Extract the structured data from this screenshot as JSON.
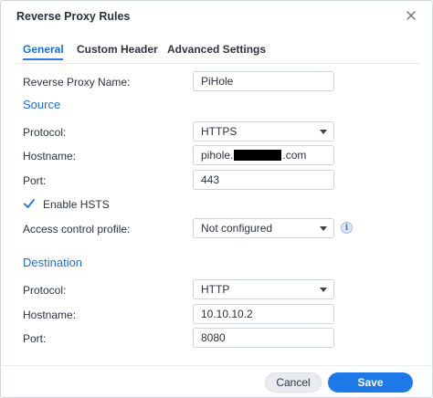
{
  "dialog": {
    "title": "Reverse Proxy Rules"
  },
  "tabs": [
    {
      "label": "General",
      "active": true
    },
    {
      "label": "Custom Header",
      "active": false
    },
    {
      "label": "Advanced Settings",
      "active": false
    }
  ],
  "general": {
    "name_label": "Reverse Proxy Name:",
    "name_value": "PiHole"
  },
  "source": {
    "heading": "Source",
    "protocol_label": "Protocol:",
    "protocol_value": "HTTPS",
    "hostname_label": "Hostname:",
    "hostname_prefix": "pihole.",
    "hostname_suffix": ".com",
    "port_label": "Port:",
    "port_value": "443",
    "hsts_label": "Enable HSTS",
    "hsts_checked": true,
    "acl_label": "Access control profile:",
    "acl_value": "Not configured"
  },
  "destination": {
    "heading": "Destination",
    "protocol_label": "Protocol:",
    "protocol_value": "HTTP",
    "hostname_label": "Hostname:",
    "hostname_value": "10.10.10.2",
    "port_label": "Port:",
    "port_value": "8080"
  },
  "footer": {
    "cancel_label": "Cancel",
    "save_label": "Save"
  },
  "colors": {
    "accent": "#1e79e8",
    "section_heading": "#1e6ed0",
    "checkbox_check": "#2d7ae4"
  },
  "icons": {
    "close": "close-icon",
    "dropdown": "chevron-down-icon",
    "info": "info-icon",
    "check": "check-icon"
  }
}
